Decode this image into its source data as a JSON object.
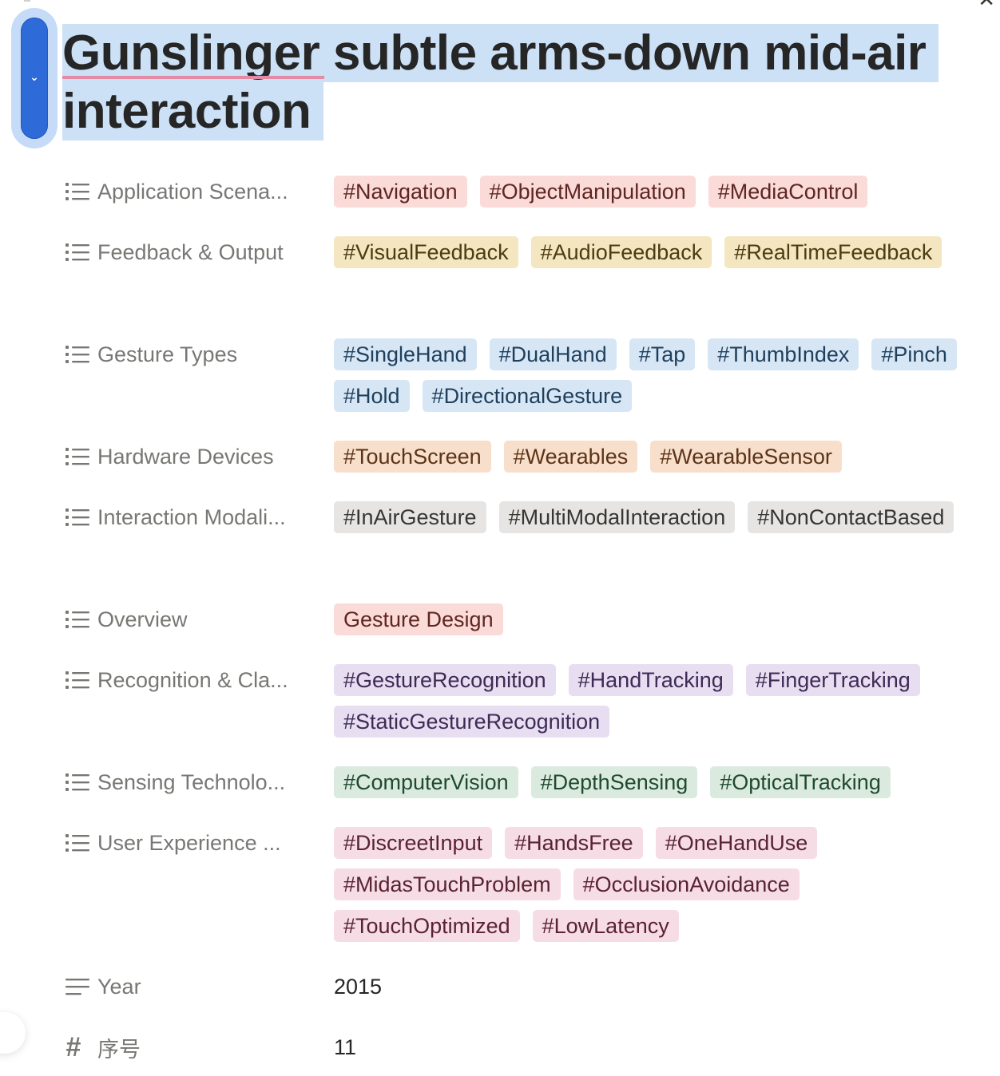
{
  "title": "Gunslinger subtle arms-down mid-air interaction",
  "properties": [
    {
      "name": "Application Scena...",
      "icon": "list-icon",
      "color": "red",
      "tags": [
        "#Navigation",
        "#ObjectManipulation",
        "#MediaControl"
      ]
    },
    {
      "name": "Feedback & Output",
      "icon": "list-icon",
      "color": "yellow",
      "tags": [
        "#VisualFeedback",
        "#AudioFeedback",
        "#RealTimeFeedback"
      ]
    },
    {
      "name": "Gesture Types",
      "icon": "list-icon",
      "color": "blue",
      "tags": [
        "#SingleHand",
        "#DualHand",
        "#Tap",
        "#ThumbIndex",
        "#Pinch",
        "#Hold",
        "#DirectionalGesture"
      ]
    },
    {
      "name": "Hardware Devices",
      "icon": "list-icon",
      "color": "orange",
      "tags": [
        "#TouchScreen",
        "#Wearables",
        "#WearableSensor"
      ]
    },
    {
      "name": "Interaction Modali...",
      "icon": "list-icon",
      "color": "gray",
      "tags": [
        "#InAirGesture",
        "#MultiModalInteraction",
        "#NonContactBased"
      ]
    },
    {
      "name": "Overview",
      "icon": "list-icon",
      "color": "red",
      "tags": [
        "Gesture Design"
      ]
    },
    {
      "name": "Recognition & Cla...",
      "icon": "list-icon",
      "color": "purple",
      "tags": [
        "#GestureRecognition",
        "#HandTracking",
        "#FingerTracking",
        "#StaticGestureRecognition"
      ]
    },
    {
      "name": "Sensing Technolo...",
      "icon": "list-icon",
      "color": "green",
      "tags": [
        "#ComputerVision",
        "#DepthSensing",
        "#OpticalTracking"
      ]
    },
    {
      "name": "User Experience ...",
      "icon": "list-icon",
      "color": "pink",
      "tags": [
        "#DiscreetInput",
        "#HandsFree",
        "#OneHandUse",
        "#MidasTouchProblem",
        "#OcclusionAvoidance",
        "#TouchOptimized",
        "#LowLatency"
      ]
    },
    {
      "name": "Year",
      "icon": "text-lines-icon",
      "value": "2015"
    },
    {
      "name": "序号",
      "icon": "hash-icon",
      "value": "11"
    }
  ],
  "colors": {
    "handle": "#2f6ad9",
    "title_highlight": "#cce0f6"
  }
}
